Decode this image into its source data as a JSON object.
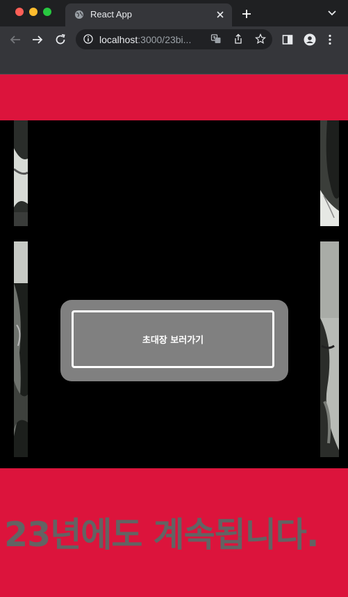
{
  "browser": {
    "tab_title": "React App",
    "url_host": "localhost",
    "url_rest": ":3000/23bi..."
  },
  "colors": {
    "page_background": "#dc143c",
    "film_background": "#000000",
    "modal_background": "#808080",
    "footer_text": "#636363"
  },
  "modal": {
    "button_label": "초대장 보러가기"
  },
  "footer": {
    "headline": "23년에도 계속됩니다."
  }
}
